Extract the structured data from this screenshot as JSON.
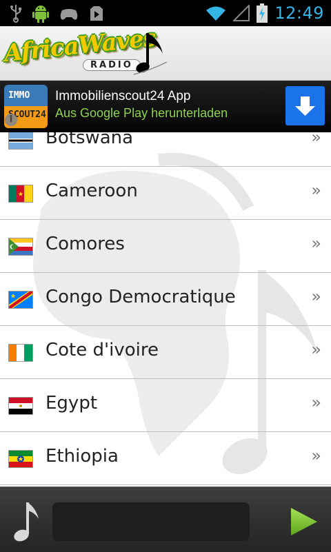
{
  "status_bar": {
    "time": "12:49",
    "left_icons": [
      "usb-icon",
      "android-robot-icon",
      "game-controller-icon",
      "play-store-icon"
    ],
    "right_icons": [
      "wifi-icon",
      "signal-icon",
      "battery-charging-icon"
    ],
    "accent": "#33b5e5"
  },
  "header": {
    "logo_text": "AfricaWaves",
    "logo_sub": "RADIO"
  },
  "ad": {
    "icon_top": "IMMO",
    "icon_bottom": "SCOUT24",
    "title": "Immobilienscout24 App",
    "subtitle": "Aus Google Play herunterladen",
    "info_icon": "info-icon",
    "download_icon": "download-arrow-icon"
  },
  "countries": [
    {
      "name": "Botswana",
      "flag": "botswana"
    },
    {
      "name": "Cameroon",
      "flag": "cameroon"
    },
    {
      "name": "Comores",
      "flag": "comores"
    },
    {
      "name": "Congo Democratique",
      "flag": "congo-dr"
    },
    {
      "name": "Cote d'ivoire",
      "flag": "cote-divoire"
    },
    {
      "name": "Egypt",
      "flag": "egypt"
    },
    {
      "name": "Ethiopia",
      "flag": "ethiopia"
    }
  ],
  "row_arrow": "»",
  "player": {
    "track_text": ""
  }
}
